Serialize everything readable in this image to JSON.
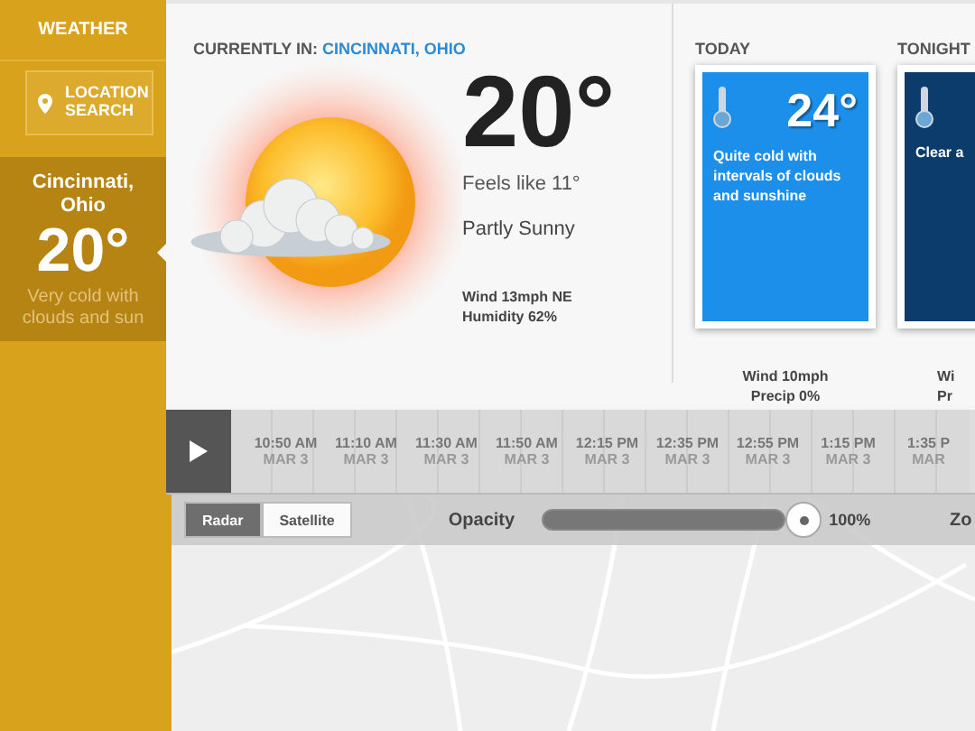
{
  "sidebar": {
    "title": "WEATHER",
    "search_button": "LOCATION SEARCH",
    "locations": [
      {
        "city": "Cincinnati, Ohio",
        "temp": "20°",
        "summary": "Very cold with clouds and sun",
        "selected": true
      }
    ]
  },
  "current": {
    "label": "CURRENTLY IN:",
    "location": "CINCINNATI, OHIO",
    "temp": "20°",
    "feels_like": "Feels like 11°",
    "condition": "Partly Sunny",
    "wind": "Wind 13mph NE",
    "humidity": "Humidity 62%"
  },
  "forecast": [
    {
      "kind": "day",
      "label": "TODAY",
      "temp": "24°",
      "description": "Quite cold with intervals of clouds and sunshine",
      "wind": "Wind 10mph",
      "precip": "Precip 0%"
    },
    {
      "kind": "night",
      "label": "TONIGHT",
      "description": "Clear a",
      "wind": "Wi",
      "precip": "Pr"
    }
  ],
  "timeline": {
    "times": [
      {
        "time": "10:50 AM",
        "date": "MAR 3"
      },
      {
        "time": "11:10 AM",
        "date": "MAR 3"
      },
      {
        "time": "11:30 AM",
        "date": "MAR 3"
      },
      {
        "time": "11:50 AM",
        "date": "MAR 3"
      },
      {
        "time": "12:15 PM",
        "date": "MAR 3"
      },
      {
        "time": "12:35 PM",
        "date": "MAR 3"
      },
      {
        "time": "12:55 PM",
        "date": "MAR 3"
      },
      {
        "time": "1:15 PM",
        "date": "MAR 3"
      },
      {
        "time": "1:35 P",
        "date": "MAR"
      }
    ]
  },
  "map": {
    "layers": [
      {
        "label": "Radar",
        "selected": true
      },
      {
        "label": "Satellite",
        "selected": false
      }
    ],
    "opacity": {
      "label": "Opacity",
      "level": 1.0,
      "reading": "100%"
    },
    "zoom_label": "Zo"
  }
}
